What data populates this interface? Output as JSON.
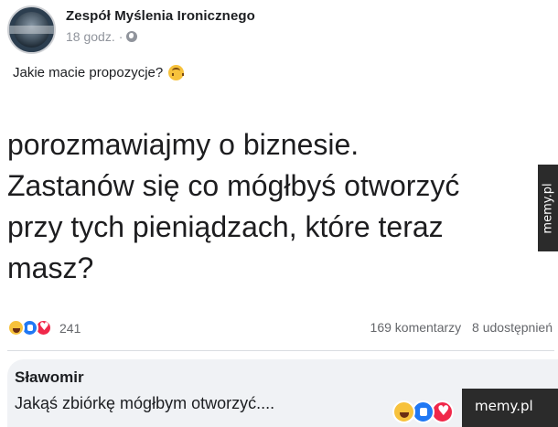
{
  "post": {
    "page_name": "Zespół Myślenia Ironicznego",
    "time": "18 godz.",
    "separator": "·",
    "audience_icon": "globe-icon",
    "text": "Jakie macie propozycje?",
    "text_emoji": "upside-down-face-emoji"
  },
  "image": {
    "lines": [
      "porozmawiajmy o biznesie.",
      "Zastanów się co mógłbyś otworzyć",
      "przy tych pieniądzach, które teraz",
      "masz?"
    ]
  },
  "stats": {
    "reaction_icons": [
      "haha-icon",
      "like-icon",
      "love-icon"
    ],
    "reaction_count": "241",
    "comments": "169 komentarzy",
    "shares": "8 udostępnień"
  },
  "comment": {
    "author": "Sławomir",
    "text": "Jakąś zbiórkę mógłbym otworzyć....",
    "reaction_icons": [
      "haha-icon",
      "like-icon",
      "love-icon"
    ]
  },
  "watermarks": {
    "side": "memy.pl",
    "bottom": "memy.pl"
  },
  "colors": {
    "like": "#2078f4",
    "love": "#f0284a",
    "haha": "#f7c23c",
    "secondary_text": "#65676b",
    "comment_bg": "#f0f2f5"
  }
}
